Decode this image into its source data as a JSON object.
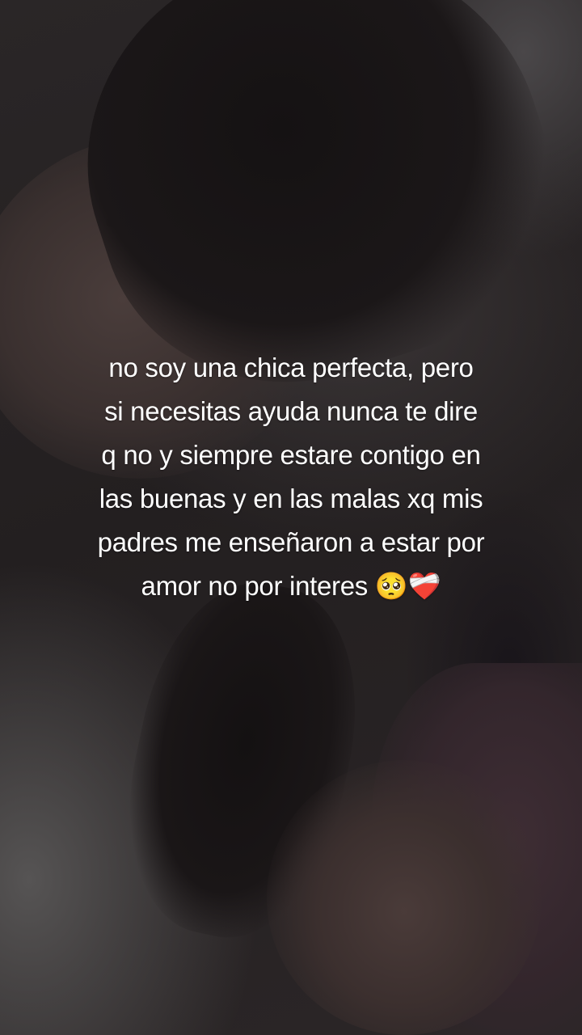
{
  "overlay_text": {
    "caption": "no soy una chica perfecta, pero\nsi necesitas ayuda nunca te dire\nq no y siempre estare contigo en\nlas buenas y en las malas xq mis\npadres me enseñaron a estar por\namor no por interes 🥺❤️‍🩹"
  },
  "background": {
    "description_colors": [
      "#1e1c1d",
      "#3a3536",
      "#565454",
      "#4a3d3b",
      "#3e2d34"
    ]
  }
}
